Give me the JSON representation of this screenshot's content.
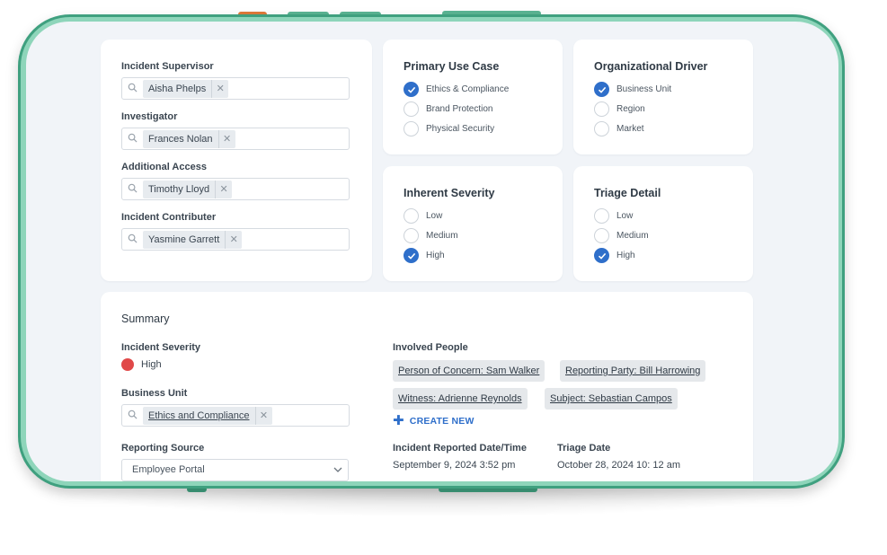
{
  "people_fields": [
    {
      "label": "Incident Supervisor",
      "value": "Aisha Phelps"
    },
    {
      "label": "Investigator",
      "value": "Frances Nolan"
    },
    {
      "label": "Additional Access",
      "value": "Timothy Lloyd"
    },
    {
      "label": "Incident Contributer",
      "value": "Yasmine Garrett"
    }
  ],
  "primary_use_case": {
    "title": "Primary Use Case",
    "options": [
      {
        "label": "Ethics & Compliance",
        "checked": true
      },
      {
        "label": "Brand Protection",
        "checked": false
      },
      {
        "label": "Physical Security",
        "checked": false
      }
    ]
  },
  "organizational_driver": {
    "title": "Organizational Driver",
    "options": [
      {
        "label": "Business Unit",
        "checked": true
      },
      {
        "label": "Region",
        "checked": false
      },
      {
        "label": "Market",
        "checked": false
      }
    ]
  },
  "inherent_severity": {
    "title": "Inherent Severity",
    "options": [
      {
        "label": "Low",
        "checked": false
      },
      {
        "label": "Medium",
        "checked": false
      },
      {
        "label": "High",
        "checked": true
      }
    ]
  },
  "triage_detail": {
    "title": "Triage Detail",
    "options": [
      {
        "label": "Low",
        "checked": false
      },
      {
        "label": "Medium",
        "checked": false
      },
      {
        "label": "High",
        "checked": true
      }
    ]
  },
  "summary": {
    "title": "Summary",
    "incident_severity_label": "Incident Severity",
    "incident_severity_value": "High",
    "severity_color": "#e04848",
    "business_unit_label": "Business Unit",
    "business_unit_value": "Ethics and Compliance",
    "reporting_source_label": "Reporting Source",
    "reporting_source_value": "Employee Portal",
    "involved_people_label": "Involved People",
    "involved_people": [
      "Person of Concern: Sam Walker",
      "Reporting Party: Bill Harrowing",
      "Witness: Adrienne Reynolds",
      "Subject: Sebastian Campos"
    ],
    "create_new_label": "CREATE NEW",
    "reported_date_label": "Incident Reported Date/Time",
    "reported_date_value": "September 9, 2024 3:52 pm",
    "triage_date_label": "Triage Date",
    "triage_date_value": "October 28, 2024 10: 12 am"
  },
  "colors": {
    "accent": "#2f6fca",
    "frame": "#8ed5ba",
    "frame_edge": "#3fa07f",
    "severity_high": "#e04848"
  }
}
